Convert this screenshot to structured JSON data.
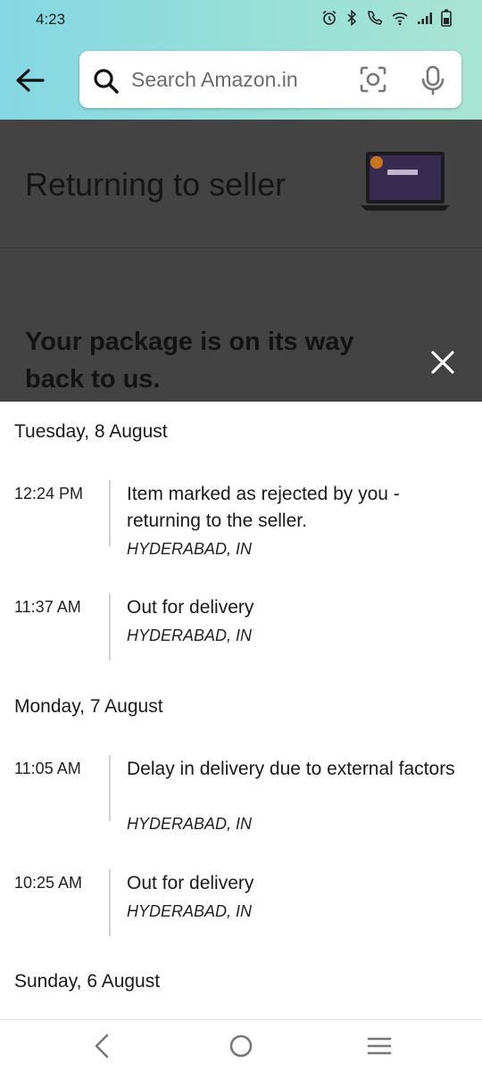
{
  "status_bar": {
    "time": "4:23"
  },
  "header": {
    "search_placeholder": "Search Amazon.in"
  },
  "tracking": {
    "status_title": "Returning to seller",
    "message": "Your package is on its way back to us."
  },
  "timeline": [
    {
      "day": "Tuesday, 8 August",
      "events": [
        {
          "time": "12:24 PM",
          "desc": "Item marked as rejected by you - returning to the seller.",
          "location": "HYDERABAD, IN"
        },
        {
          "time": "11:37 AM",
          "desc": "Out for delivery",
          "location": "HYDERABAD, IN"
        }
      ]
    },
    {
      "day": "Monday, 7 August",
      "events": [
        {
          "time": "11:05 AM",
          "desc": "Delay in delivery due to external factors",
          "location": "HYDERABAD, IN"
        },
        {
          "time": "10:25 AM",
          "desc": "Out for delivery",
          "location": "HYDERABAD, IN"
        }
      ]
    },
    {
      "day": "Sunday, 6 August",
      "events": []
    }
  ],
  "icons": {
    "back": "back-arrow-icon",
    "search": "search-icon",
    "lens": "camera-lens-icon",
    "mic": "microphone-icon",
    "close": "close-icon"
  },
  "colors": {
    "header_gradient_start": "#84d8e3",
    "header_gradient_end": "#a9e4d2",
    "overlay": "#434343"
  }
}
